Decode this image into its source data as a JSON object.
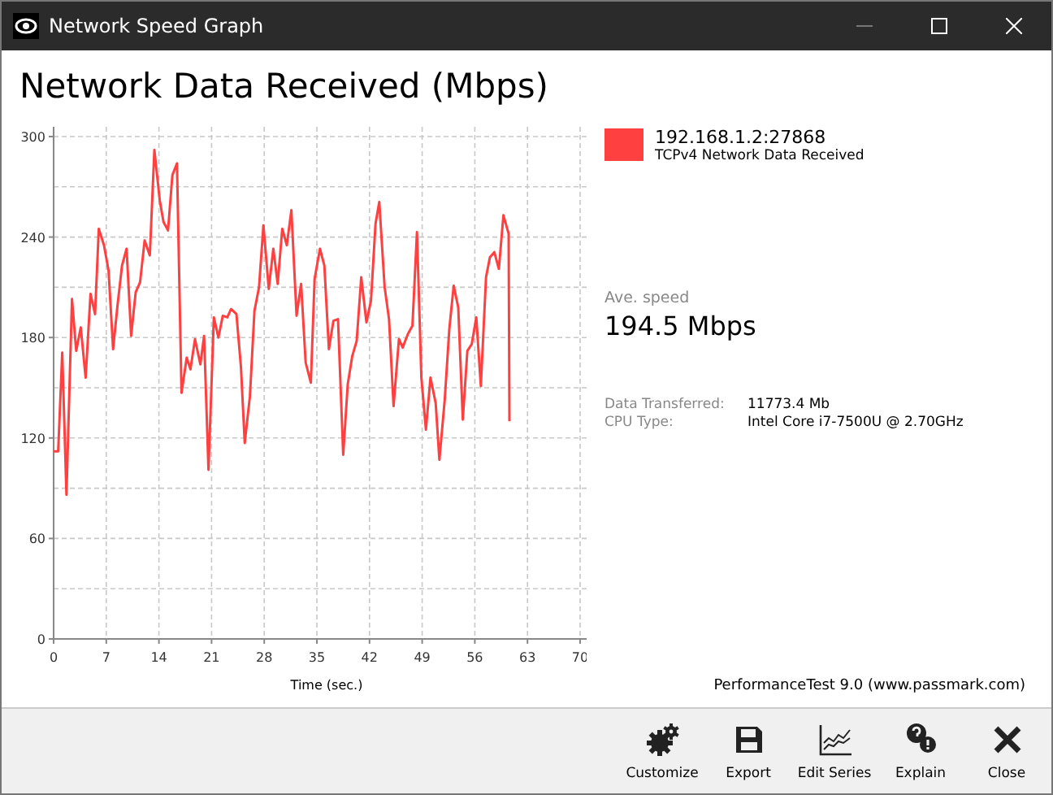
{
  "window": {
    "title": "Network Speed Graph"
  },
  "heading": "Network Data Received (Mbps)",
  "chart": {
    "chart_data": {
      "type": "line",
      "grid": true,
      "xlabel": "Time (sec.)",
      "xlim": [
        0,
        70
      ],
      "ylim": [
        0,
        300
      ],
      "xticks": [
        0,
        7,
        14,
        21,
        28,
        35,
        42,
        49,
        56,
        63,
        70
      ],
      "yticks": [
        0,
        60,
        120,
        180,
        240,
        300
      ],
      "x": [
        0,
        0.6,
        1.15,
        1.7,
        2.45,
        3,
        3.6,
        4.25,
        4.9,
        5.5,
        6,
        6.7,
        7.3,
        7.9,
        8.5,
        9.1,
        9.7,
        10.3,
        10.9,
        11.5,
        12.1,
        12.8,
        13.4,
        14.1,
        14.6,
        15.2,
        15.8,
        16.4,
        17,
        17.7,
        18.2,
        18.8,
        19.5,
        20,
        20.6,
        21.3,
        21.9,
        22.5,
        23.1,
        23.6,
        24.3,
        24.9,
        25.4,
        26.1,
        26.7,
        27.3,
        27.9,
        28.6,
        29.2,
        29.8,
        30.4,
        31,
        31.6,
        32.3,
        32.9,
        33.5,
        34.2,
        34.7,
        35.4,
        36,
        36.6,
        37.2,
        37.8,
        38.5,
        39.1,
        39.7,
        40.3,
        40.9,
        41.6,
        42.2,
        42.8,
        43.3,
        44,
        44.6,
        45.2,
        45.9,
        46.4,
        47.1,
        47.7,
        48.3,
        48.9,
        49.5,
        50.1,
        50.8,
        51.3,
        52,
        52.6,
        53.2,
        53.8,
        54.4,
        55,
        55.6,
        56.2,
        56.8,
        57.5,
        58,
        58.6,
        59.2,
        59.8,
        60.5,
        60.6
      ],
      "series": [
        {
          "name": "192.168.1.2:27868",
          "color": "#ff4040",
          "values": [
            112,
            112,
            171,
            86,
            203,
            172,
            186,
            156,
            206,
            194,
            245,
            235,
            220,
            173,
            199,
            223,
            233,
            181,
            207,
            213,
            238,
            229,
            292,
            262,
            249,
            244,
            277,
            284,
            147,
            168,
            161,
            179,
            164,
            181,
            101,
            192,
            180,
            193,
            192,
            197,
            194,
            162,
            117,
            145,
            196,
            210,
            247,
            209,
            233,
            212,
            245,
            235,
            256,
            193,
            212,
            165,
            153,
            215,
            233,
            223,
            173,
            190,
            191,
            110,
            152,
            169,
            178,
            216,
            189,
            202,
            248,
            261,
            210,
            191,
            139,
            179,
            174,
            182,
            187,
            243,
            156,
            125,
            156,
            141,
            107,
            143,
            185,
            211,
            198,
            131,
            172,
            176,
            192,
            151,
            216,
            228,
            231,
            221,
            253,
            242,
            130
          ]
        }
      ]
    }
  },
  "legend": [
    {
      "description": "TCPv4 Network Data Received"
    }
  ],
  "average": {
    "label": "Ave. speed",
    "value": "194.5 Mbps"
  },
  "details": [
    {
      "label": "Data Transferred:",
      "value": "11773.4 Mb"
    },
    {
      "label": "CPU Type:",
      "value": "Intel Core i7-7500U @ 2.70GHz"
    }
  ],
  "credit": "PerformanceTest 9.0 (www.passmark.com)",
  "toolbar": [
    {
      "label": "Customize",
      "kind": "gears"
    },
    {
      "label": "Export",
      "kind": "save"
    },
    {
      "label": "Edit Series",
      "kind": "series"
    },
    {
      "label": "Explain",
      "kind": "help"
    },
    {
      "label": "Close",
      "kind": "close"
    }
  ]
}
